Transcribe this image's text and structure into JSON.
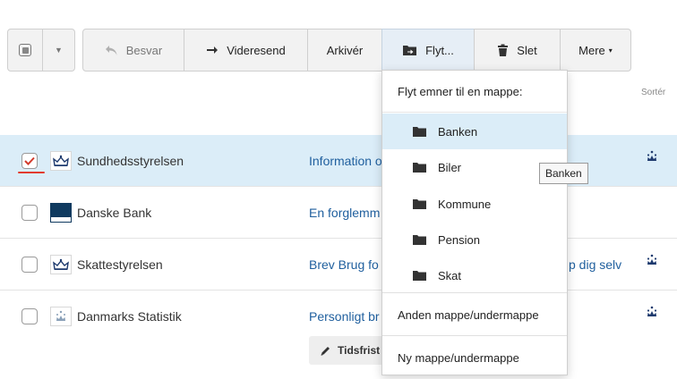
{
  "toolbar": {
    "reply_label": "Besvar",
    "forward_label": "Videresend",
    "archive_label": "Arkivér",
    "move_label": "Flyt...",
    "delete_label": "Slet",
    "more_label": "Mere",
    "more_caret": "▾"
  },
  "sort_label": "Sortér",
  "messages": [
    {
      "sender": "Sundhedsstyrelsen",
      "subject": "Information o",
      "subject_tail": "",
      "checked": true
    },
    {
      "sender": "Danske Bank",
      "subject": "En forglemm",
      "subject_tail": "",
      "checked": false
    },
    {
      "sender": "Skattestyrelsen",
      "subject": "Brev Brug fo",
      "subject_tail": "p dig selv",
      "checked": false
    },
    {
      "sender": "Danmarks Statistik",
      "subject": "Personligt br",
      "subject_tail": "",
      "checked": false
    }
  ],
  "deadline_label": "Tidsfrist",
  "move_menu": {
    "header": "Flyt emner til en mappe:",
    "folders": [
      "Banken",
      "Biler",
      "Kommune",
      "Pension",
      "Skat"
    ],
    "other_folder": "Anden mappe/undermappe",
    "new_folder": "Ny mappe/undermappe"
  },
  "tooltip": "Banken",
  "colors": {
    "accent_red": "#e23b2e",
    "link_blue": "#1f5f9e",
    "selected_row": "#dbedf8"
  }
}
